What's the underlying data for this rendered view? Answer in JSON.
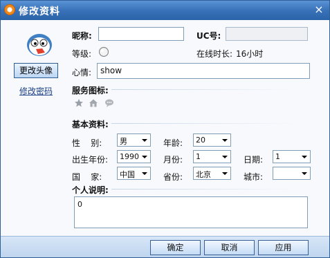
{
  "window": {
    "title": "修改资料",
    "close_glyph": "×"
  },
  "left": {
    "change_avatar": "更改头像",
    "change_password": "修改密码"
  },
  "basic_top": {
    "nickname_label": "昵称:",
    "nickname_value": "",
    "uc_label": "UC号:",
    "uc_value": "",
    "level_label": "等级:",
    "online_label": "在线时长:",
    "online_value": "16小时",
    "mood_label": "心情:",
    "mood_value": "show"
  },
  "service": {
    "label": "服务图标:"
  },
  "basic": {
    "label": "基本资料:",
    "gender_label": "性    别:",
    "gender_value": "男",
    "age_label": "年龄:",
    "age_value": "20",
    "birth_year_label": "出生年份:",
    "birth_year_value": "1990",
    "month_label": "月份:",
    "month_value": "1",
    "day_label": "日期:",
    "day_value": "1",
    "country_label": "国    家:",
    "country_value": "中国",
    "province_label": "省份:",
    "province_value": "北京",
    "city_label": "城市:",
    "city_value": ""
  },
  "personal": {
    "label": "个人说明:",
    "value": "0"
  },
  "footer": {
    "ok": "确定",
    "cancel": "取消",
    "apply": "应用"
  },
  "icons": [
    "app-logo-icon",
    "avatar-penguin",
    "star-level-icon",
    "star-service-icon",
    "home-service-icon",
    "chat-service-icon",
    "dropdown-arrow-icon"
  ],
  "colors": {
    "titlebar": "#3a72b9",
    "accent_border": "#7f9db9",
    "footer": "#c9dcf1"
  }
}
